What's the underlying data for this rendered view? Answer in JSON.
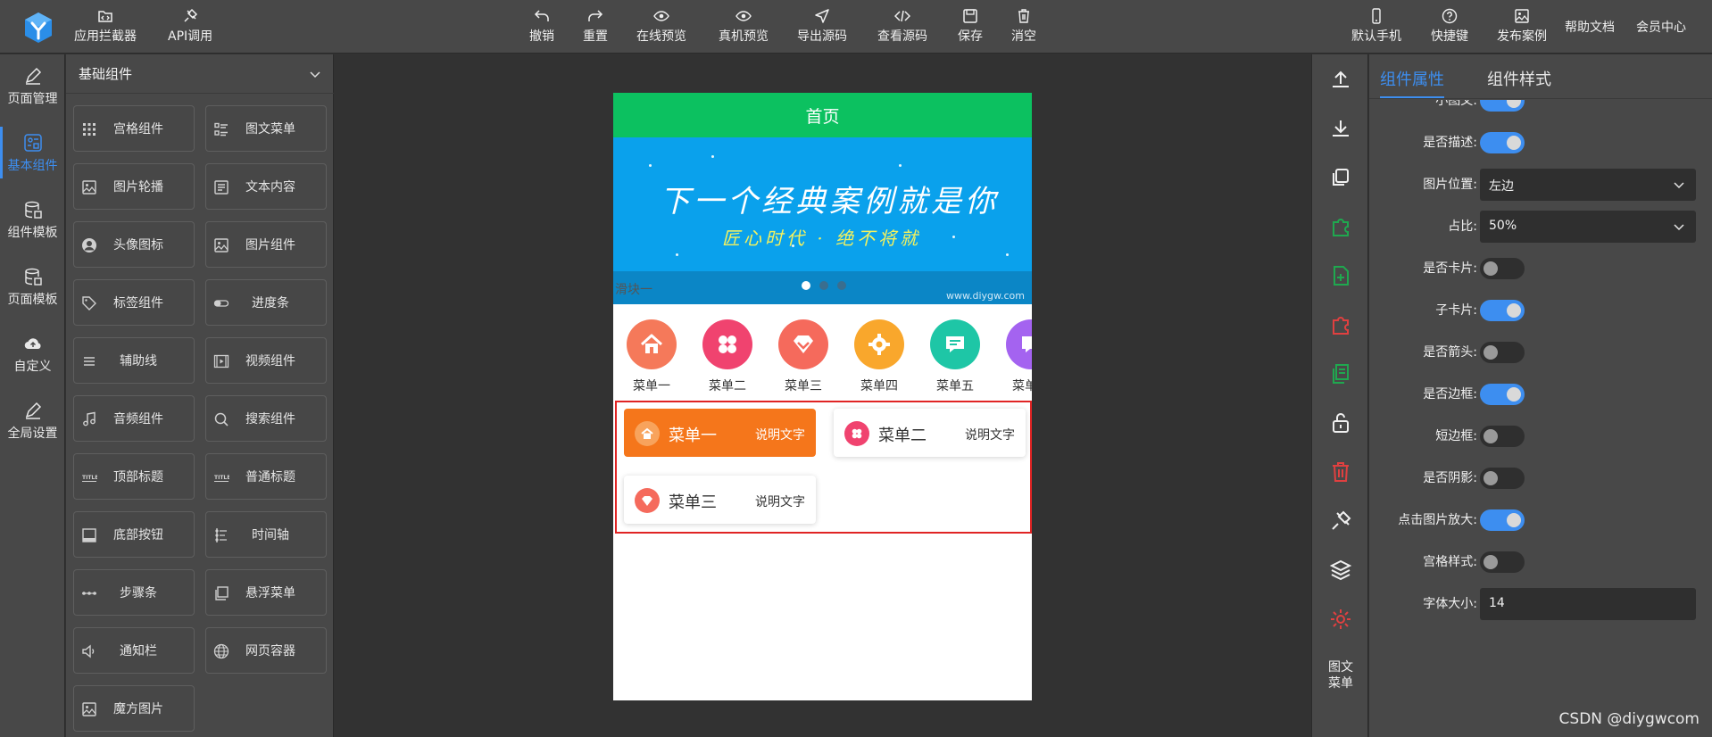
{
  "toolbar": {
    "left": [
      {
        "label": "应用拦截器",
        "icon": "folder-code-icon"
      },
      {
        "label": "API调用",
        "icon": "plug-icon"
      }
    ],
    "center": [
      {
        "label": "撤销",
        "icon": "undo-icon"
      },
      {
        "label": "重置",
        "icon": "redo-icon"
      },
      {
        "label": "在线预览",
        "icon": "eye-icon"
      },
      {
        "label": "真机预览",
        "icon": "eye-icon"
      },
      {
        "label": "导出源码",
        "icon": "send-icon"
      },
      {
        "label": "查看源码",
        "icon": "code-icon"
      },
      {
        "label": "保存",
        "icon": "save-icon"
      },
      {
        "label": "消空",
        "icon": "trash-icon"
      }
    ],
    "right": [
      {
        "label": "默认手机",
        "icon": "phone-icon"
      },
      {
        "label": "快捷键",
        "icon": "help-icon"
      },
      {
        "label": "发布案例",
        "icon": "image-icon"
      },
      {
        "label": "帮助文档"
      },
      {
        "label": "会员中心"
      }
    ]
  },
  "leftnav": [
    {
      "label": "页面管理",
      "icon": "pencil-icon",
      "active": false
    },
    {
      "label": "基本组件",
      "icon": "components-icon",
      "active": true
    },
    {
      "label": "组件模板",
      "icon": "database-icon",
      "active": false
    },
    {
      "label": "页面模板",
      "icon": "database-icon",
      "active": false
    },
    {
      "label": "自定义",
      "icon": "cloud-upload-icon",
      "active": false
    },
    {
      "label": "全局设置",
      "icon": "pencil-icon",
      "active": false
    }
  ],
  "panel": {
    "title": "基础组件",
    "components": [
      {
        "label": "宫格组件",
        "icon": "grid-icon"
      },
      {
        "label": "图文菜单",
        "icon": "list-icon"
      },
      {
        "label": "图片轮播",
        "icon": "image-icon"
      },
      {
        "label": "文本内容",
        "icon": "text-icon"
      },
      {
        "label": "头像图标",
        "icon": "avatar-icon"
      },
      {
        "label": "图片组件",
        "icon": "image-icon"
      },
      {
        "label": "标签组件",
        "icon": "tag-icon"
      },
      {
        "label": "进度条",
        "icon": "progress-icon"
      },
      {
        "label": "辅助线",
        "icon": "lines-icon"
      },
      {
        "label": "视频组件",
        "icon": "video-icon"
      },
      {
        "label": "音频组件",
        "icon": "music-icon"
      },
      {
        "label": "搜索组件",
        "icon": "search-icon"
      },
      {
        "label": "顶部标题",
        "icon": "title-icon"
      },
      {
        "label": "普通标题",
        "icon": "title-icon"
      },
      {
        "label": "底部按钮",
        "icon": "footer-icon"
      },
      {
        "label": "时间轴",
        "icon": "timeline-icon"
      },
      {
        "label": "步骤条",
        "icon": "steps-icon"
      },
      {
        "label": "悬浮菜单",
        "icon": "float-icon"
      },
      {
        "label": "通知栏",
        "icon": "speaker-icon"
      },
      {
        "label": "网页容器",
        "icon": "globe-icon"
      },
      {
        "label": "魔方图片",
        "icon": "image-icon"
      }
    ]
  },
  "phone": {
    "header_title": "首页",
    "banner": {
      "line1": "下一个经典案例就是你",
      "line2": "匠心时代 · 绝不将就",
      "caption": "滑块一",
      "watermark": "www.diygw.com",
      "active_dot": 0,
      "dot_count": 3
    },
    "menu": [
      {
        "label": "菜单一",
        "color": "#f5795a",
        "icon": "home-icon"
      },
      {
        "label": "菜单二",
        "color": "#f0436f",
        "icon": "clover-icon"
      },
      {
        "label": "菜单三",
        "color": "#f56a5c",
        "icon": "diamond-icon"
      },
      {
        "label": "菜单四",
        "color": "#f9a72c",
        "icon": "gear-icon"
      },
      {
        "label": "菜单五",
        "color": "#1ec6a6",
        "icon": "message-icon"
      },
      {
        "label": "菜单六",
        "color": "#a463f0",
        "icon": "message-icon"
      }
    ],
    "cards": [
      {
        "name": "菜单一",
        "desc": "说明文字",
        "style": "orange",
        "icon": "home-icon",
        "icon_color": "#f8a35c"
      },
      {
        "name": "菜单二",
        "desc": "说明文字",
        "style": "white",
        "icon": "clover-icon",
        "icon_color": "#f0436f"
      },
      {
        "name": "菜单三",
        "desc": "说明文字",
        "style": "white",
        "icon": "diamond-icon",
        "icon_color": "#f56a5c"
      }
    ]
  },
  "toolstrip": {
    "bottom_label_1": "图文",
    "bottom_label_2": "菜单"
  },
  "props": {
    "tabs": [
      "组件属性",
      "组件样式"
    ],
    "active_tab": 0,
    "partial_top_label": "小图文:",
    "rows": [
      {
        "label": "是否描述:",
        "type": "switch",
        "on": true
      },
      {
        "label": "图片位置:",
        "type": "select",
        "value": "左边"
      },
      {
        "label": "占比:",
        "type": "select",
        "value": "50%"
      },
      {
        "label": "是否卡片:",
        "type": "switch",
        "on": false
      },
      {
        "label": "子卡片:",
        "type": "switch",
        "on": true
      },
      {
        "label": "是否箭头:",
        "type": "switch",
        "on": false
      },
      {
        "label": "是否边框:",
        "type": "switch",
        "on": true
      },
      {
        "label": "短边框:",
        "type": "switch",
        "on": false
      },
      {
        "label": "是否阴影:",
        "type": "switch",
        "on": false
      },
      {
        "label": "点击图片放大:",
        "type": "switch",
        "on": true
      },
      {
        "label": "宫格样式:",
        "type": "switch",
        "on": false
      }
    ],
    "partial_bottom_label": "字体大小:",
    "partial_bottom_value": "14"
  },
  "watermark": "CSDN @diygwcom"
}
